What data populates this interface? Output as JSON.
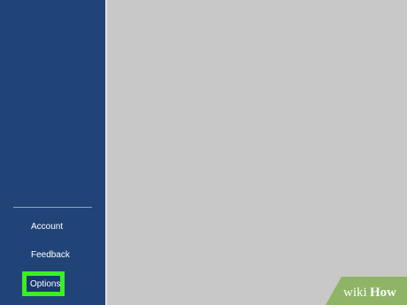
{
  "sidebar": {
    "items": [
      {
        "label": "Account"
      },
      {
        "label": "Feedback"
      },
      {
        "label": "Options"
      }
    ]
  },
  "watermark": {
    "text_wiki": "wiki",
    "text_how": "How"
  },
  "colors": {
    "sidebar_bg": "#214478",
    "main_bg": "#c8c8c8",
    "highlight": "#3bf021",
    "watermark_bg": "#8db565"
  }
}
